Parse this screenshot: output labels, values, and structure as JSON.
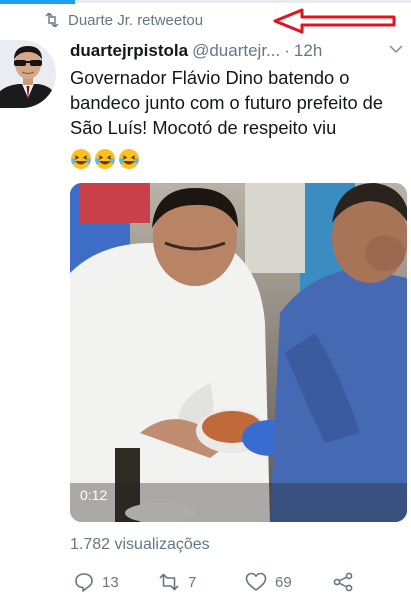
{
  "retweet_bar": {
    "text": "Duarte Jr. retweetou",
    "icon": "retweet-icon"
  },
  "tweet": {
    "author_name": "duartejrpistola",
    "handle": "@duartejr...",
    "separator": "·",
    "time": "12h",
    "text": "Governador Flávio Dino batendo o bandeco junto com o futuro prefeito de São Luís! Mocotó de respeito viu",
    "emojis": [
      "laughing-face-icon",
      "laughing-face-icon",
      "laughing-face-icon"
    ]
  },
  "video": {
    "duration": "0:12"
  },
  "views": "1.782 visualizações",
  "actions": {
    "reply_count": "13",
    "retweet_count": "7",
    "like_count": "69"
  },
  "colors": {
    "accent": "#1da1f2",
    "muted": "#657786",
    "text": "#14171a",
    "annotation_arrow": "#e0151b"
  }
}
